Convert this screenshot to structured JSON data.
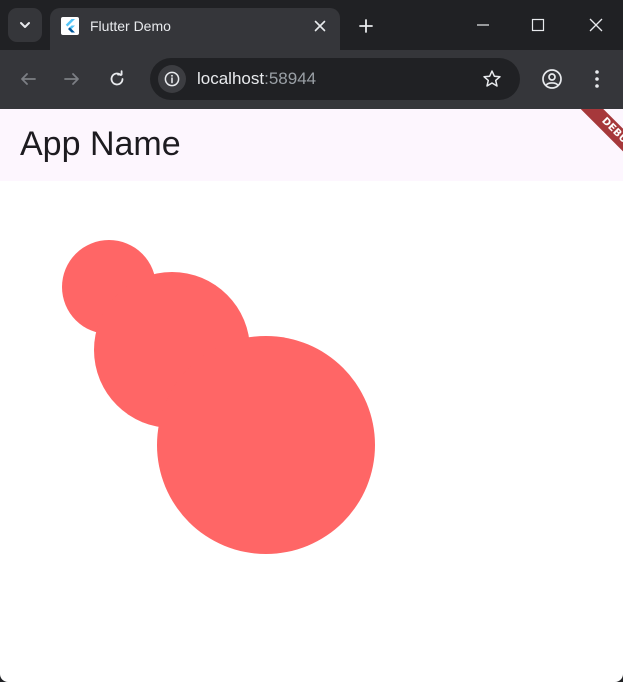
{
  "browser": {
    "tab": {
      "title": "Flutter Demo"
    },
    "address_bar": {
      "host": "localhost",
      "port": ":58944"
    }
  },
  "app": {
    "appbar_title": "App Name",
    "debug_banner": "DEBUG",
    "circle_color": "#ff6666",
    "appbar_color": "#fdf6fe"
  },
  "colors": {
    "chrome_frame": "#202124",
    "chrome_toolbar": "#35363a",
    "accent_flutter": "#54c5f8"
  }
}
